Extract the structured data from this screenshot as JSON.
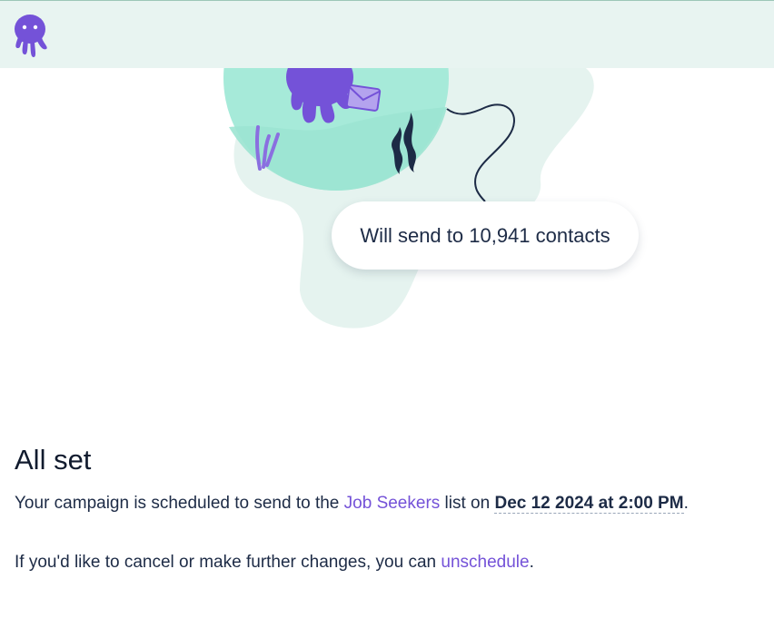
{
  "header": {
    "logo_icon": "octopus-logo-icon",
    "background": "#e8f4f1"
  },
  "illustration": {
    "bubble_text": "Will send to 10,941 contacts",
    "icons": [
      "octopus-icon",
      "envelope-icon",
      "seaweed-icon",
      "coral-icon"
    ]
  },
  "content": {
    "title": "All set",
    "line1": {
      "prefix": "Your campaign is scheduled to send to the ",
      "list_name": "Job Seekers",
      "middle": " list on ",
      "date": "Dec 12 2024 at 2:00 PM",
      "suffix": "."
    },
    "line2": {
      "prefix": "If you'd like to cancel or make further changes, you can ",
      "link": "unschedule",
      "suffix": "."
    }
  },
  "colors": {
    "accent": "#7452d8",
    "text": "#1d2b46",
    "mint": "#a6ead9",
    "blob": "#e5f3ef"
  }
}
